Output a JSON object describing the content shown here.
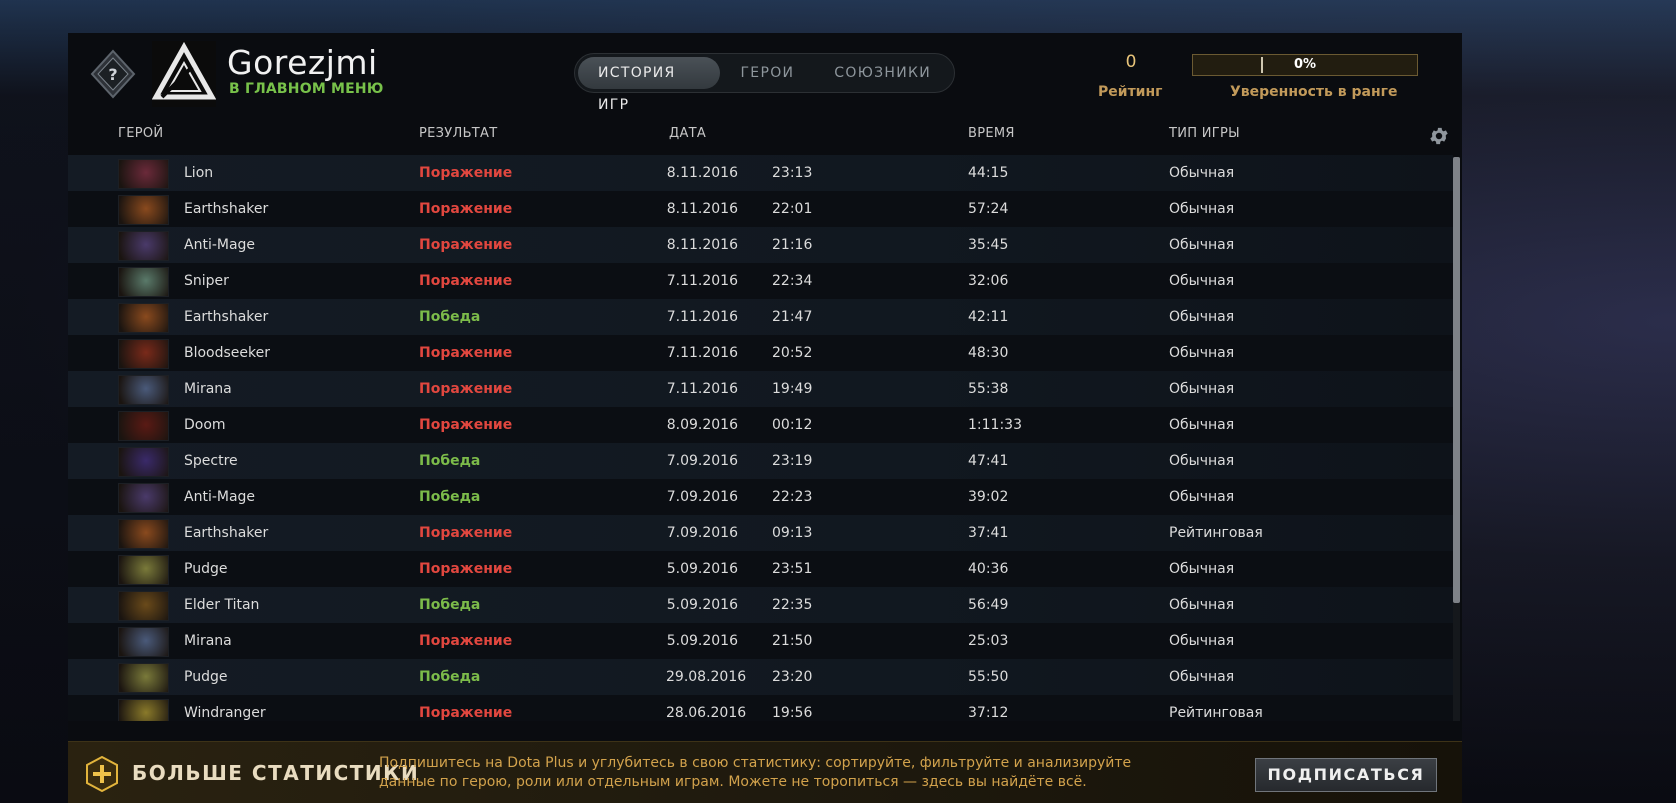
{
  "player": {
    "name": "Gorezjmi",
    "status": "В ГЛАВНОМ МЕНЮ"
  },
  "tabs": [
    {
      "label": "ИСТОРИЯ ИГР",
      "active": true
    },
    {
      "label": "ГЕРОИ",
      "active": false
    },
    {
      "label": "СОЮЗНИКИ",
      "active": false
    }
  ],
  "rating": {
    "value": "0",
    "label": "Рейтинг"
  },
  "confidence": {
    "percent": "0%",
    "fill_fraction": 0,
    "label": "Уверенность в ранге"
  },
  "columns": {
    "hero": "ГЕРОЙ",
    "result": "РЕЗУЛЬТАТ",
    "date": "ДАТА",
    "duration": "ВРЕМЯ",
    "type": "ТИП ИГРЫ"
  },
  "matches": [
    {
      "hero": "Lion",
      "result": "Поражение",
      "win": false,
      "date": "8.11.2016",
      "time": "23:13",
      "duration": "44:15",
      "type": "Обычная",
      "portrait": "#6b2a3a"
    },
    {
      "hero": "Earthshaker",
      "result": "Поражение",
      "win": false,
      "date": "8.11.2016",
      "time": "22:01",
      "duration": "57:24",
      "type": "Обычная",
      "portrait": "#8a4a1e"
    },
    {
      "hero": "Anti-Mage",
      "result": "Поражение",
      "win": false,
      "date": "8.11.2016",
      "time": "21:16",
      "duration": "35:45",
      "type": "Обычная",
      "portrait": "#4a3a6a"
    },
    {
      "hero": "Sniper",
      "result": "Поражение",
      "win": false,
      "date": "7.11.2016",
      "time": "22:34",
      "duration": "32:06",
      "type": "Обычная",
      "portrait": "#5a7a6a"
    },
    {
      "hero": "Earthshaker",
      "result": "Победа",
      "win": true,
      "date": "7.11.2016",
      "time": "21:47",
      "duration": "42:11",
      "type": "Обычная",
      "portrait": "#8a4a1e"
    },
    {
      "hero": "Bloodseeker",
      "result": "Поражение",
      "win": false,
      "date": "7.11.2016",
      "time": "20:52",
      "duration": "48:30",
      "type": "Обычная",
      "portrait": "#7a2a1a"
    },
    {
      "hero": "Mirana",
      "result": "Поражение",
      "win": false,
      "date": "7.11.2016",
      "time": "19:49",
      "duration": "55:38",
      "type": "Обычная",
      "portrait": "#4a5a7a"
    },
    {
      "hero": "Doom",
      "result": "Поражение",
      "win": false,
      "date": "8.09.2016",
      "time": "00:12",
      "duration": "1:11:33",
      "type": "Обычная",
      "portrait": "#5a1a14"
    },
    {
      "hero": "Spectre",
      "result": "Победа",
      "win": true,
      "date": "7.09.2016",
      "time": "23:19",
      "duration": "47:41",
      "type": "Обычная",
      "portrait": "#3a2a6a"
    },
    {
      "hero": "Anti-Mage",
      "result": "Победа",
      "win": true,
      "date": "7.09.2016",
      "time": "22:23",
      "duration": "39:02",
      "type": "Обычная",
      "portrait": "#4a3a6a"
    },
    {
      "hero": "Earthshaker",
      "result": "Поражение",
      "win": false,
      "date": "7.09.2016",
      "time": "09:13",
      "duration": "37:41",
      "type": "Рейтинговая",
      "portrait": "#8a4a1e"
    },
    {
      "hero": "Pudge",
      "result": "Поражение",
      "win": false,
      "date": "5.09.2016",
      "time": "23:51",
      "duration": "40:36",
      "type": "Обычная",
      "portrait": "#7a7a3a"
    },
    {
      "hero": "Elder Titan",
      "result": "Победа",
      "win": true,
      "date": "5.09.2016",
      "time": "22:35",
      "duration": "56:49",
      "type": "Обычная",
      "portrait": "#6a4a1a"
    },
    {
      "hero": "Mirana",
      "result": "Поражение",
      "win": false,
      "date": "5.09.2016",
      "time": "21:50",
      "duration": "25:03",
      "type": "Обычная",
      "portrait": "#4a5a7a"
    },
    {
      "hero": "Pudge",
      "result": "Победа",
      "win": true,
      "date": "29.08.2016",
      "time": "23:20",
      "duration": "55:50",
      "type": "Обычная",
      "portrait": "#7a7a3a"
    },
    {
      "hero": "Windranger",
      "result": "Поражение",
      "win": false,
      "date": "28.06.2016",
      "time": "19:56",
      "duration": "37:12",
      "type": "Рейтинговая",
      "portrait": "#8a7a2a"
    }
  ],
  "promo": {
    "title": "БОЛЬШЕ СТАТИСТИКИ",
    "text": "Подпишитесь на Dota Plus и углубитесь в свою статистику: сортируйте, фильтруйте и анализируйте данные по герою, роли или отдельным играм. Можете не торопиться — здесь вы найдёте всё.",
    "button": "ПОДПИСАТЬСЯ"
  },
  "colors": {
    "loss": "#e1473f",
    "win": "#7cbb4a",
    "accent_gold": "#c29a5a",
    "status_green": "#78c24a"
  },
  "icons": {
    "rank": "unknown-rank-medal-icon",
    "avatar": "dota-logo-avatar-icon",
    "settings": "gear-icon",
    "promo": "dota-plus-icon"
  }
}
